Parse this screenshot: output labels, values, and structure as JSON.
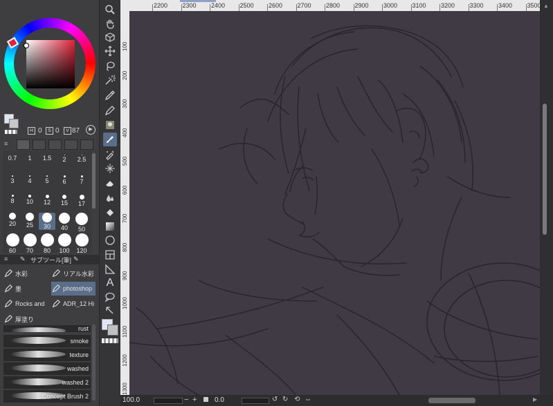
{
  "color": {
    "opacity_a": "0",
    "opacity_b": "0",
    "value": "87"
  },
  "brush_sizes": [
    [
      "0.7",
      "1",
      "1.5",
      "2",
      "2.5"
    ],
    [
      "3",
      "4",
      "5",
      "6",
      "7"
    ],
    [
      "8",
      "10",
      "12",
      "15",
      "17"
    ],
    [
      "20",
      "25",
      "30",
      "40",
      "50"
    ],
    [
      "60",
      "70",
      "80",
      "100",
      "120"
    ]
  ],
  "subtool": {
    "header": "サブツール[筆]",
    "items": [
      "水彩",
      "リアル水彩",
      "墨",
      "photoshop",
      "Rocks and",
      "ADR_12 Hi",
      "厚塗り"
    ],
    "selected": "photoshop"
  },
  "brush_list": [
    "rust",
    "smoke",
    "texture",
    "washed",
    "washed 2",
    "Concept Brush 2"
  ],
  "ruler_top": [
    "2200",
    "2300",
    "2400",
    "2500",
    "2600",
    "2700",
    "2800",
    "2900",
    "3000",
    "3100",
    "3200",
    "3300",
    "3400",
    "3500"
  ],
  "ruler_left": [
    "100",
    "200",
    "300",
    "400",
    "500",
    "600",
    "700",
    "800",
    "900",
    "1000",
    "1100",
    "1200",
    "1300"
  ],
  "status": {
    "zoom": "100.0",
    "angle": "0.0"
  }
}
